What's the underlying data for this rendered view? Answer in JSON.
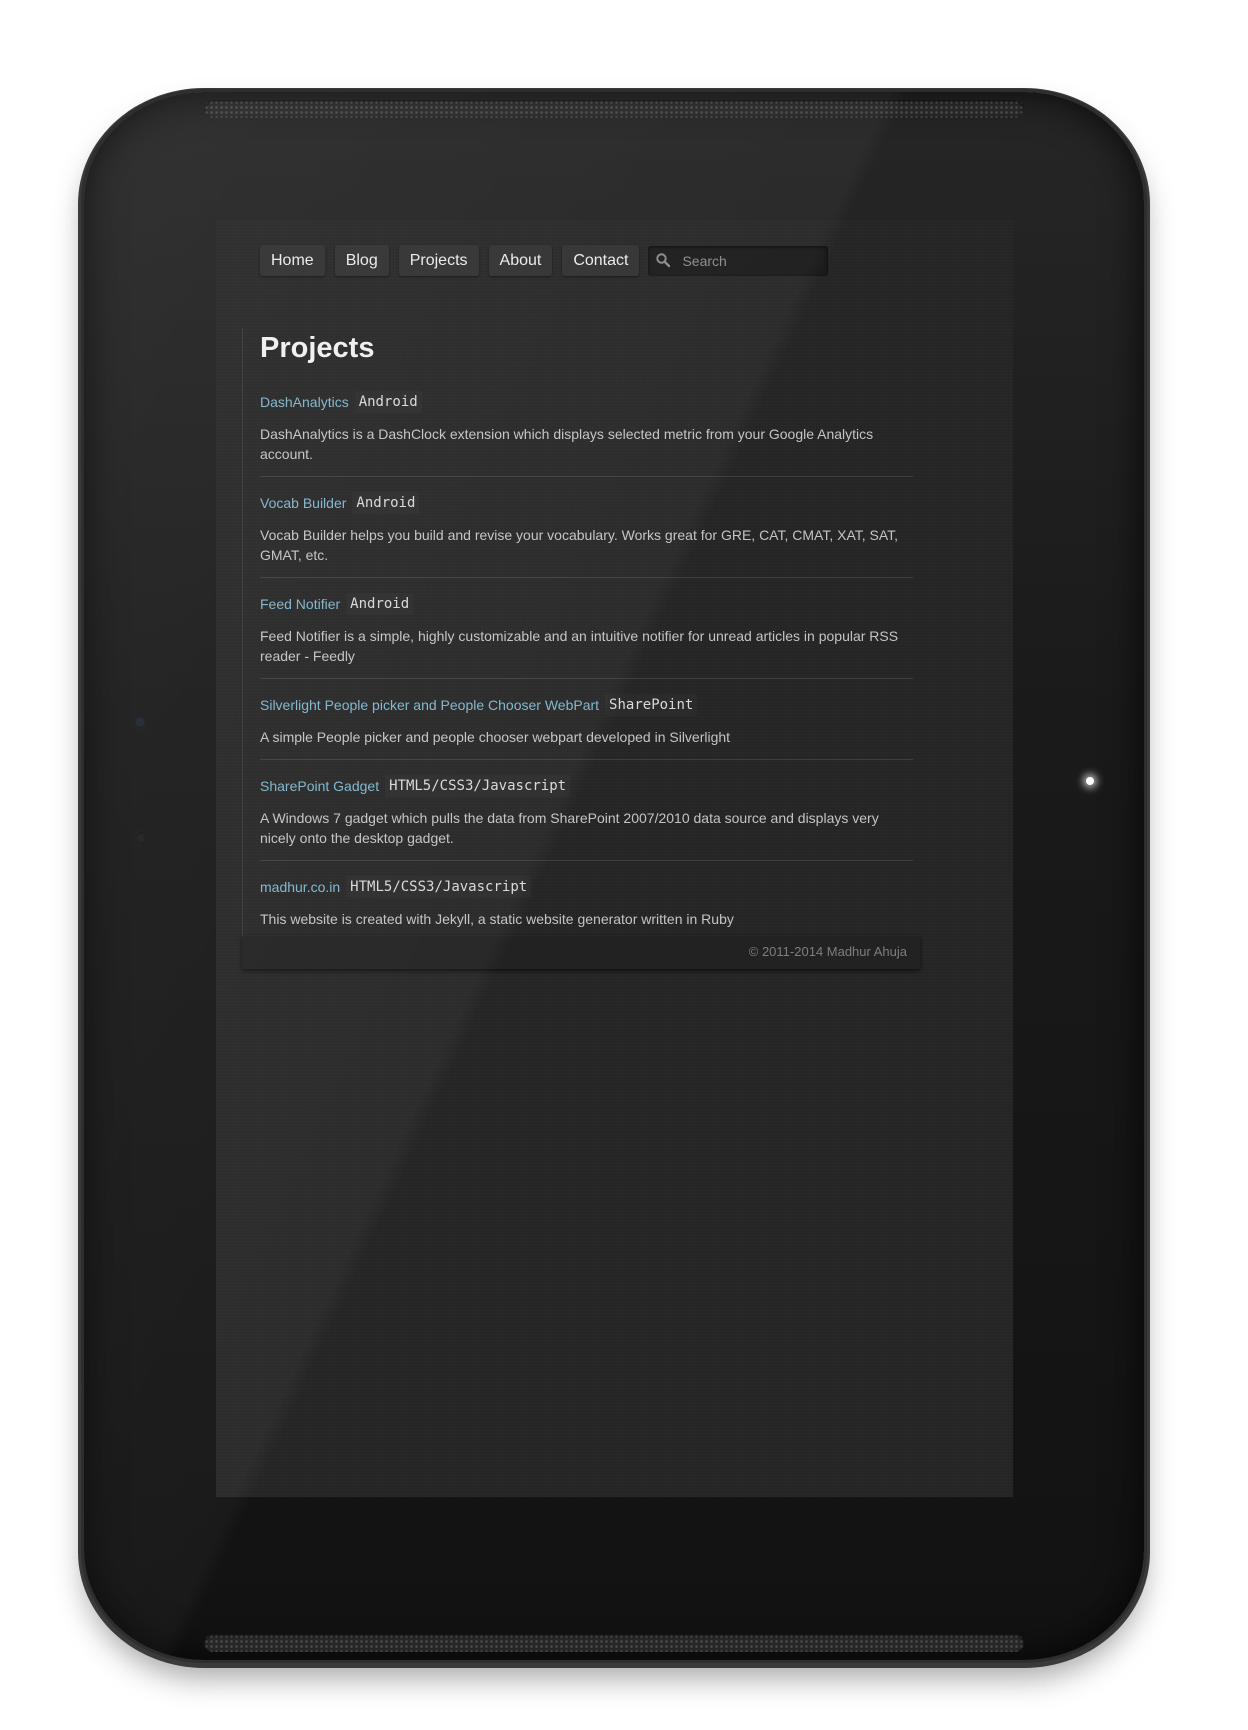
{
  "nav": {
    "items": [
      {
        "label": "Home"
      },
      {
        "label": "Blog"
      },
      {
        "label": "Projects"
      },
      {
        "label": "About"
      },
      {
        "label": "Contact"
      }
    ],
    "search": {
      "placeholder": "Search"
    }
  },
  "page": {
    "title": "Projects"
  },
  "projects": [
    {
      "name": "DashAnalytics",
      "tag": "Android",
      "description": "DashAnalytics is a DashClock extension which displays selected metric from your Google Analytics account."
    },
    {
      "name": "Vocab Builder",
      "tag": "Android",
      "description": "Vocab Builder helps you build and revise your vocabulary. Works great for GRE, CAT, CMAT, XAT, SAT, GMAT, etc."
    },
    {
      "name": "Feed Notifier",
      "tag": "Android",
      "description": "Feed Notifier is a simple, highly customizable and an intuitive notifier for unread articles in popular RSS reader - Feedly"
    },
    {
      "name": "Silverlight People picker and People Chooser WebPart",
      "tag": "SharePoint",
      "description": "A simple People picker and people chooser webpart developed in Silverlight"
    },
    {
      "name": "SharePoint Gadget",
      "tag": "HTML5/CSS3/Javascript",
      "description": "A Windows 7 gadget which pulls the data from SharePoint 2007/2010 data source and displays very nicely onto the desktop gadget."
    },
    {
      "name": "madhur.co.in",
      "tag": "HTML5/CSS3/Javascript",
      "description": "This website is created with Jekyll, a static website generator written in Ruby"
    }
  ],
  "footer": {
    "copyright": "© 2011-2014 Madhur Ahuja"
  },
  "colors": {
    "link": "#7fb6cd",
    "background": "#262626",
    "nav_button": "#303030"
  },
  "icons": {
    "search": "search-icon"
  }
}
